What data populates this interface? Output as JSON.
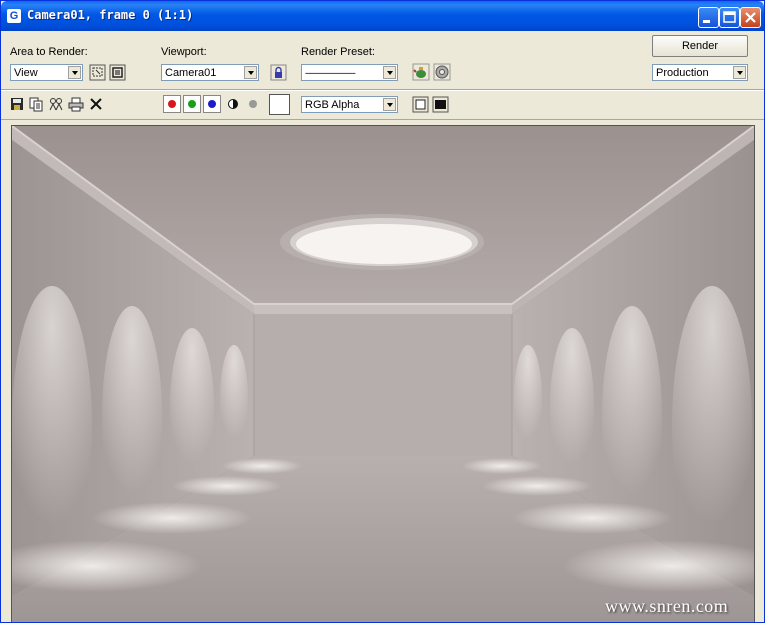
{
  "window": {
    "title": "Camera01, frame 0 (1:1)"
  },
  "controls": {
    "area_label": "Area to Render:",
    "area_value": "View",
    "viewport_label": "Viewport:",
    "viewport_value": "Camera01",
    "preset_label": "Render Preset:",
    "preset_value": "-------------------------",
    "render_button": "Render",
    "mode_value": "Production"
  },
  "toolbar": {
    "channel_value": "RGB Alpha",
    "colors": {
      "red": "#d81818",
      "green": "#18a018",
      "blue": "#1c1cc8"
    }
  },
  "watermark": "www.snren.com",
  "render_colors": {
    "ceiling": "#a69c9a",
    "wall": "#b2aaa8",
    "floor": "#a8a09e",
    "light": "#f4f0ee"
  }
}
